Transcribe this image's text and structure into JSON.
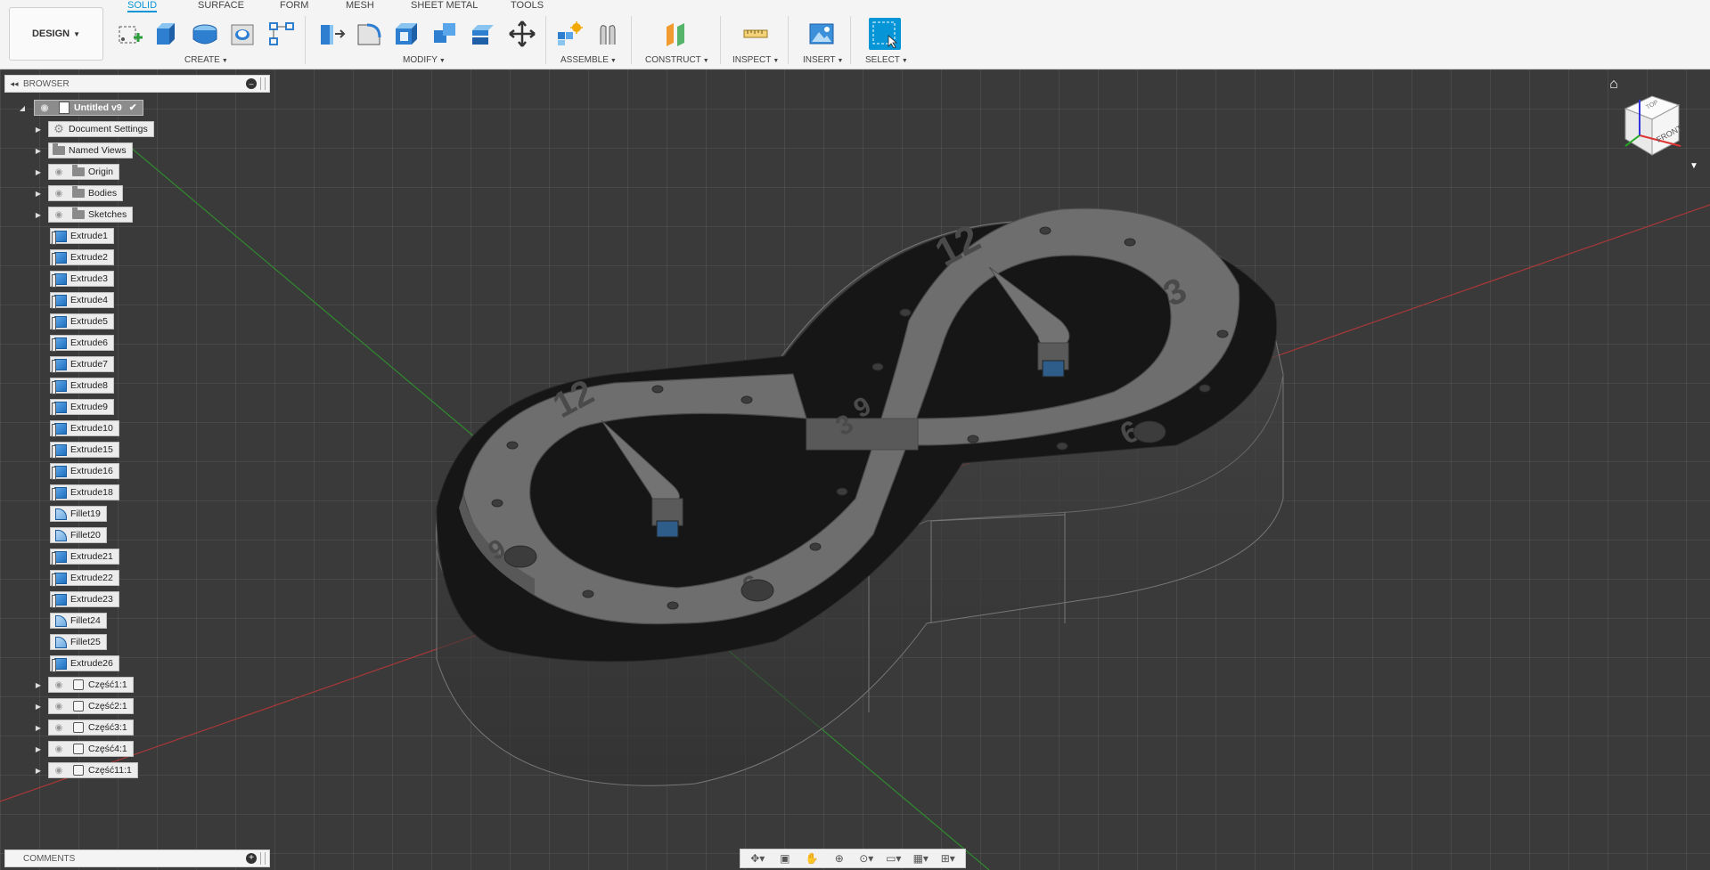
{
  "toolbar": {
    "design_label": "DESIGN",
    "tabs": [
      {
        "label": "SOLID",
        "active": true
      },
      {
        "label": "SURFACE",
        "active": false
      },
      {
        "label": "FORM",
        "active": false
      },
      {
        "label": "MESH",
        "active": false
      },
      {
        "label": "SHEET METAL",
        "active": false
      },
      {
        "label": "TOOLS",
        "active": false
      }
    ],
    "groups": {
      "create": "CREATE",
      "modify": "MODIFY",
      "assemble": "ASSEMBLE",
      "construct": "CONSTRUCT",
      "inspect": "INSPECT",
      "insert": "INSERT",
      "select": "SELECT"
    },
    "icons": {
      "create": [
        "create-sketch-icon",
        "extrude-icon",
        "revolve-icon",
        "hole-icon",
        "pattern-icon"
      ],
      "modify": [
        "press-pull-icon",
        "fillet-icon",
        "shell-icon",
        "combine-icon",
        "offset-face-icon",
        "move-copy-icon"
      ],
      "assemble": [
        "new-component-icon",
        "joint-icon"
      ],
      "construct": [
        "offset-plane-icon"
      ],
      "inspect": [
        "measure-icon"
      ],
      "insert": [
        "insert-image-icon"
      ],
      "select": [
        "select-icon"
      ]
    },
    "accent_color": "#0696d7"
  },
  "browser": {
    "title": "BROWSER",
    "root": "Untitled v9",
    "folders": [
      {
        "label": "Document Settings",
        "icon": "gear-icon"
      },
      {
        "label": "Named Views",
        "icon": "folder-icon"
      },
      {
        "label": "Origin",
        "icon": "folder-icon"
      },
      {
        "label": "Bodies",
        "icon": "folder-icon"
      },
      {
        "label": "Sketches",
        "icon": "folder-icon"
      }
    ],
    "features": [
      {
        "label": "Extrude1",
        "type": "extrude"
      },
      {
        "label": "Extrude2",
        "type": "extrude"
      },
      {
        "label": "Extrude3",
        "type": "extrude"
      },
      {
        "label": "Extrude4",
        "type": "extrude"
      },
      {
        "label": "Extrude5",
        "type": "extrude"
      },
      {
        "label": "Extrude6",
        "type": "extrude"
      },
      {
        "label": "Extrude7",
        "type": "extrude"
      },
      {
        "label": "Extrude8",
        "type": "extrude"
      },
      {
        "label": "Extrude9",
        "type": "extrude"
      },
      {
        "label": "Extrude10",
        "type": "extrude"
      },
      {
        "label": "Extrude15",
        "type": "extrude"
      },
      {
        "label": "Extrude16",
        "type": "extrude"
      },
      {
        "label": "Extrude18",
        "type": "extrude"
      },
      {
        "label": "Fillet19",
        "type": "fillet"
      },
      {
        "label": "Fillet20",
        "type": "fillet"
      },
      {
        "label": "Extrude21",
        "type": "extrude"
      },
      {
        "label": "Extrude22",
        "type": "extrude"
      },
      {
        "label": "Extrude23",
        "type": "extrude"
      },
      {
        "label": "Fillet24",
        "type": "fillet"
      },
      {
        "label": "Fillet25",
        "type": "fillet"
      },
      {
        "label": "Extrude26",
        "type": "extrude"
      }
    ],
    "components": [
      "Część1:1",
      "Część2:1",
      "Część3:1",
      "Część4:1",
      "Część11:1"
    ]
  },
  "comments": {
    "title": "COMMENTS"
  },
  "viewcube": {
    "face_label": "FRONT",
    "side_label": "TOP"
  },
  "model": {
    "dial_numbers": [
      "12",
      "3",
      "6",
      "9",
      "12",
      "3",
      "6",
      "9"
    ]
  },
  "navbar": {
    "icons": [
      "orbit-icon",
      "look-at-icon",
      "pan-icon",
      "zoom-icon",
      "fit-icon",
      "display-settings-icon",
      "grid-icon",
      "viewports-icon"
    ]
  }
}
